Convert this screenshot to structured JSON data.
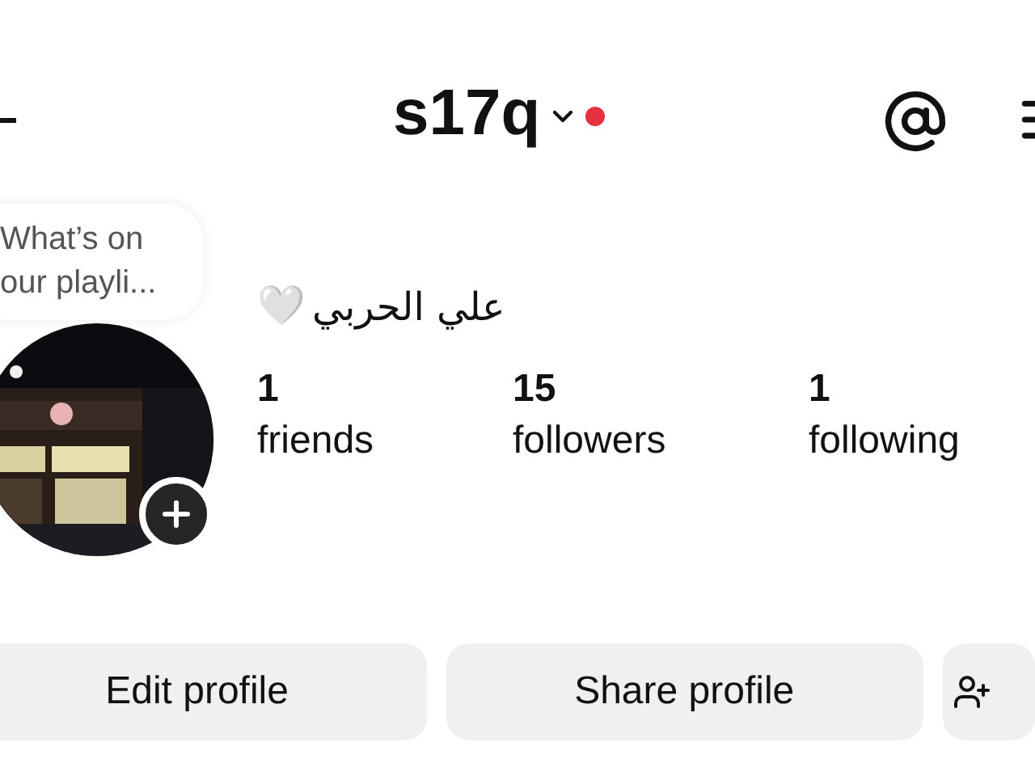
{
  "header": {
    "username": "s17q",
    "notification_dot": true
  },
  "note": {
    "lines": [
      "What’s on",
      "our playli..."
    ]
  },
  "profile": {
    "name": "علي الحربي",
    "emoji": "🤍"
  },
  "stats": [
    {
      "value": "1",
      "label": "friends"
    },
    {
      "value": "15",
      "label": "followers"
    },
    {
      "value": "1",
      "label": "following"
    }
  ],
  "buttons": [
    {
      "label": "Edit profile"
    },
    {
      "label": "Share profile"
    }
  ]
}
